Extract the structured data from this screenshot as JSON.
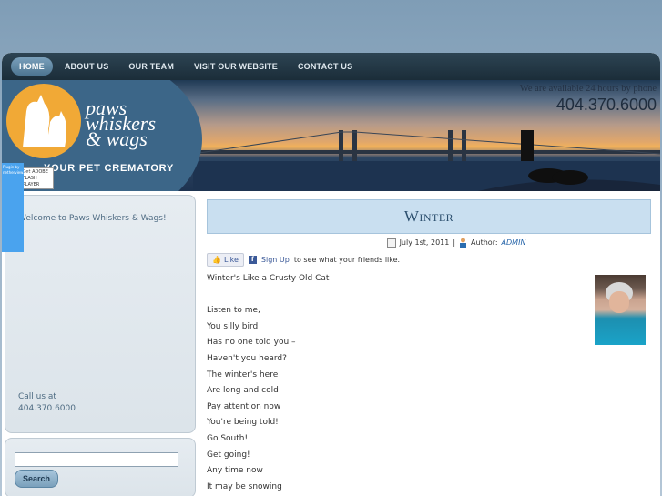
{
  "nav": {
    "items": [
      {
        "label": "HOME"
      },
      {
        "label": "ABOUT US"
      },
      {
        "label": "OUR TEAM"
      },
      {
        "label": "VISIT OUR WEBSITE"
      },
      {
        "label": "CONTACT US"
      }
    ],
    "active": "HOME"
  },
  "banner": {
    "logo_line1": "paws",
    "logo_line2": "whiskers",
    "logo_line3": "& wags",
    "tagline": "YOUR PET CREMATORY",
    "availability": "We are available 24 hours by phone",
    "phone": "404.370.6000"
  },
  "flash": {
    "line1": "Get ADOBE",
    "line2": "FLASH PLAYER",
    "plugin_text": "Plugin by netherview.com"
  },
  "sidebar": {
    "welcome": "Welcome to Paws Whiskers & Wags!",
    "call_label": "Call us at",
    "call_phone": "404.370.6000",
    "search_button": "Search",
    "search_value": ""
  },
  "post": {
    "title": "Winter",
    "date": "July 1st, 2011",
    "separator": "|",
    "author_label": "Author:",
    "author": "ADMIN",
    "like_label": "Like",
    "signup_label": "Sign Up",
    "signup_text": "to see what your friends like.",
    "lines": [
      "Winter's Like a Crusty Old Cat",
      "",
      "Listen to me,",
      "You silly bird",
      "Has no one told you –",
      "Haven't you heard?",
      "The winter's here",
      "Are long and cold",
      "Pay attention now",
      "You're being told!",
      "Go South!",
      "Get going!",
      "Any time now",
      "It may be snowing"
    ]
  },
  "colors": {
    "nav_bg": "#1b2d39",
    "accent": "#f1a936",
    "title_box": "#c9dff0"
  }
}
